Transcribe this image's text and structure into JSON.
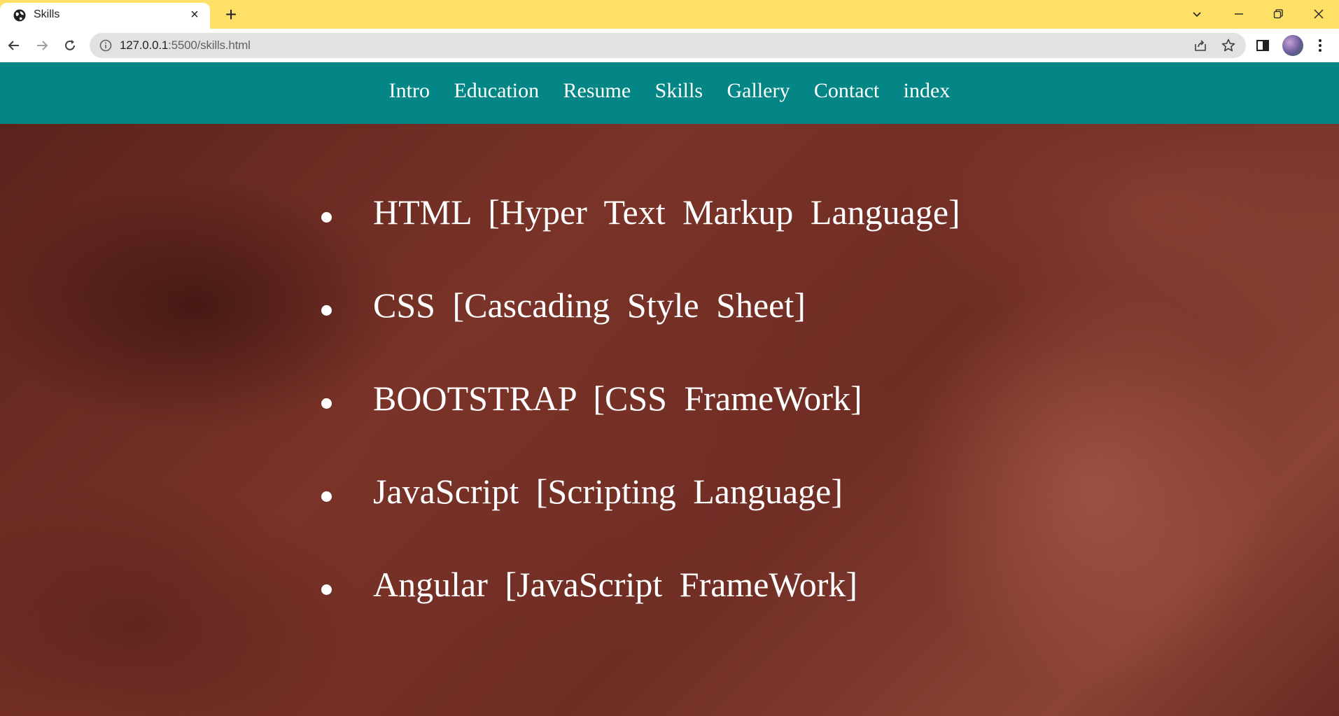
{
  "browser": {
    "tab_title": "Skills",
    "new_tab": "+",
    "close_tab": "×",
    "url_host": "127.0.0.1",
    "url_rest": ":5500/skills.html"
  },
  "nav": {
    "links": [
      "Intro",
      "Education",
      "Resume",
      "Skills",
      "Gallery",
      "Contact",
      "index"
    ]
  },
  "skills": [
    "HTML [Hyper Text Markup Language]",
    "CSS [Cascading Style Sheet]",
    "BOOTSTRAP [CSS FrameWork]",
    "JavaScript [Scripting Language]",
    "Angular [JavaScript FrameWork]"
  ],
  "colors": {
    "tabbar": "#ffe066",
    "navbar": "#038685",
    "content_base": "#6f2d24"
  }
}
